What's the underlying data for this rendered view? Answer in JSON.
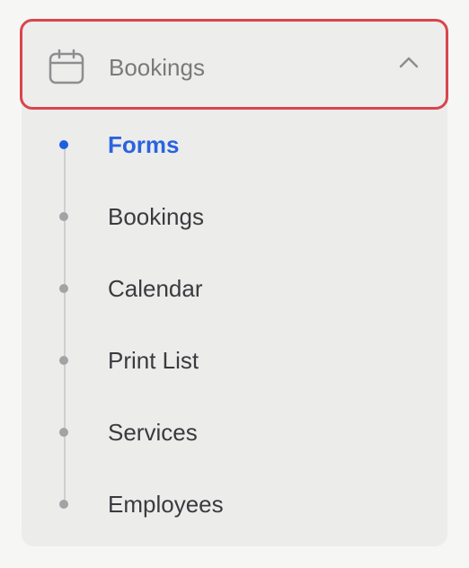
{
  "menu": {
    "header": {
      "title": "Bookings",
      "icon": "calendar-icon",
      "toggle_icon": "chevron-up-icon",
      "highlight_color": "#d9454d"
    },
    "items": [
      {
        "label": "Forms",
        "active": true
      },
      {
        "label": "Bookings",
        "active": false
      },
      {
        "label": "Calendar",
        "active": false
      },
      {
        "label": "Print List",
        "active": false
      },
      {
        "label": "Services",
        "active": false
      },
      {
        "label": "Employees",
        "active": false
      }
    ],
    "active_color": "#2a63df"
  }
}
